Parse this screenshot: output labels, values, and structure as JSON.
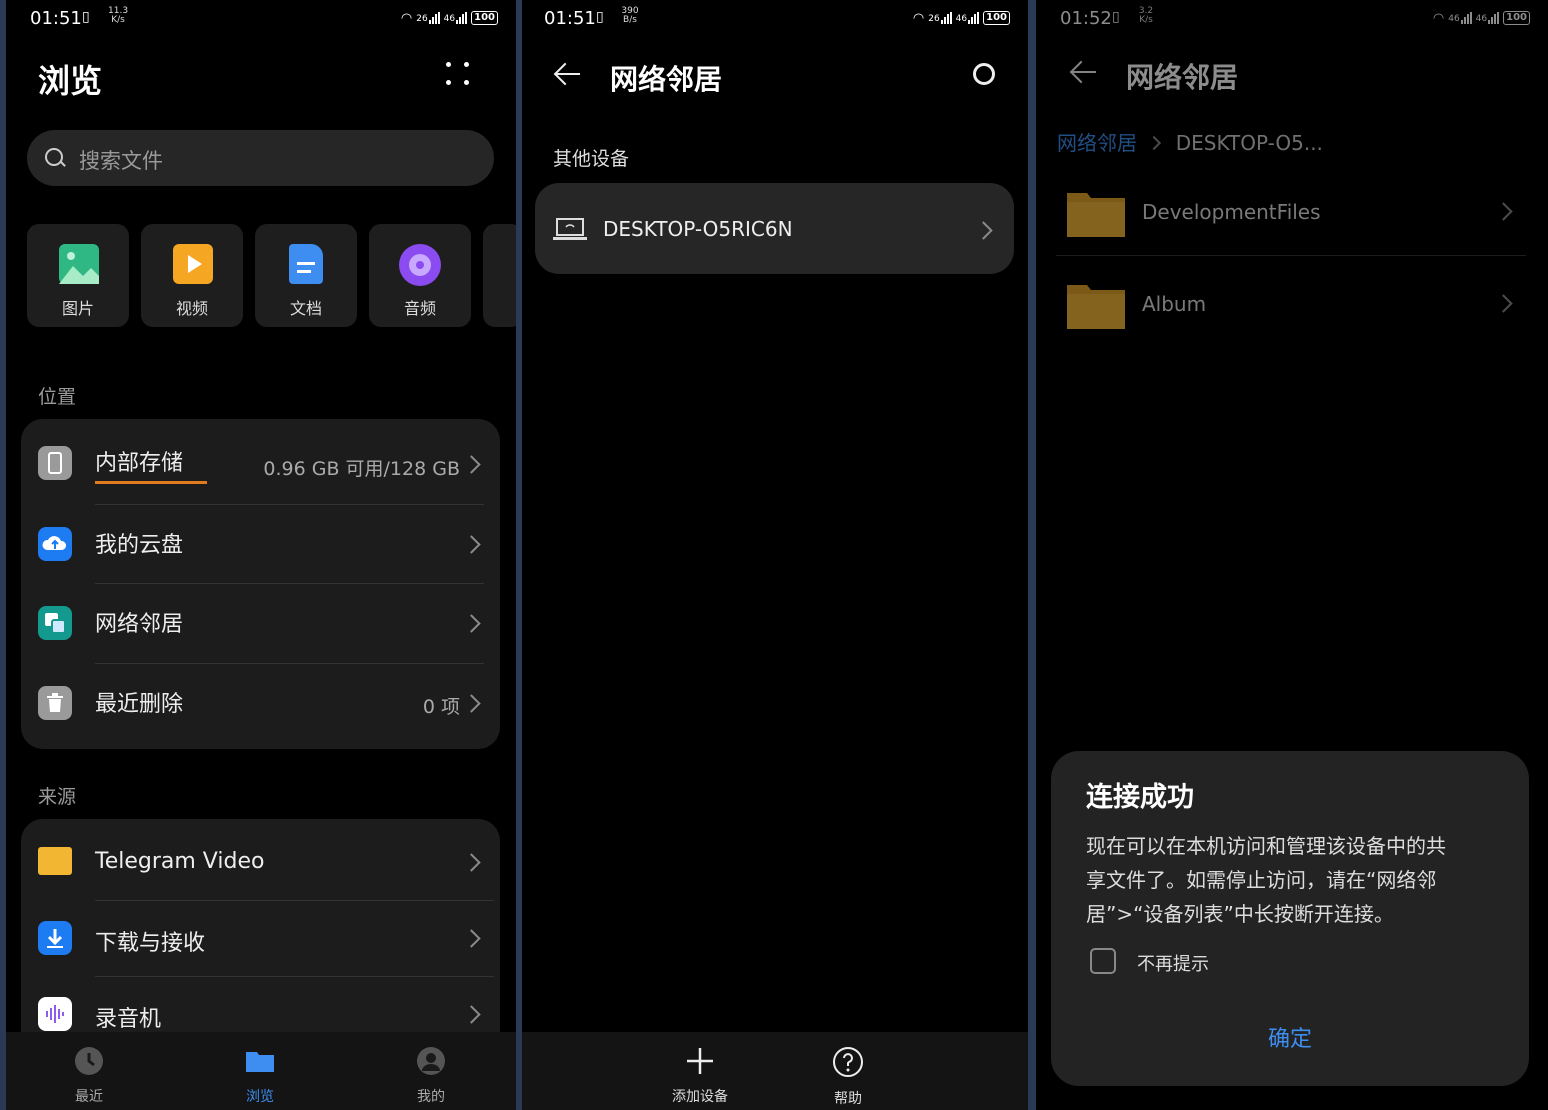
{
  "screen1": {
    "status": {
      "time": "01:51",
      "speed_top": "11.3",
      "speed_bottom": "K/s",
      "sig1": "26",
      "sig2": "46",
      "battery": "100"
    },
    "title": "浏览",
    "search_placeholder": "搜索文件",
    "categories": [
      {
        "label": "图片",
        "icon": "image-icon",
        "color": "#2fb884"
      },
      {
        "label": "视频",
        "icon": "video-icon",
        "color": "#f5a623"
      },
      {
        "label": "文档",
        "icon": "document-icon",
        "color": "#3d8ef0"
      },
      {
        "label": "音频",
        "icon": "audio-icon",
        "color": "#8a4cf0"
      }
    ],
    "locations_title": "位置",
    "locations": [
      {
        "label": "内部存储",
        "value": "0.96 GB 可用/128 GB",
        "icon": "phone-icon"
      },
      {
        "label": "我的云盘",
        "value": "",
        "icon": "cloud-icon"
      },
      {
        "label": "网络邻居",
        "value": "",
        "icon": "network-icon"
      },
      {
        "label": "最近删除",
        "value": "0 项",
        "icon": "trash-icon"
      }
    ],
    "sources_title": "来源",
    "sources": [
      {
        "label": "Telegram Video",
        "icon": "folder-icon"
      },
      {
        "label": "下载与接收",
        "icon": "download-icon"
      },
      {
        "label": "录音机",
        "icon": "recorder-icon"
      }
    ],
    "nav": [
      {
        "label": "最近",
        "icon": "clock-icon"
      },
      {
        "label": "浏览",
        "icon": "folder-icon"
      },
      {
        "label": "我的",
        "icon": "user-icon"
      }
    ],
    "accent": "#3d8ef0"
  },
  "screen2": {
    "status": {
      "time": "01:51",
      "speed_top": "390",
      "speed_bottom": "B/s",
      "sig1": "26",
      "sig2": "46",
      "battery": "100"
    },
    "title": "网络邻居",
    "section": "其他设备",
    "device": "DESKTOP-O5RIC6N",
    "nav": [
      {
        "label": "添加设备",
        "icon": "plus-icon"
      },
      {
        "label": "帮助",
        "icon": "help-icon"
      }
    ]
  },
  "screen3": {
    "status": {
      "time": "01:52",
      "speed_top": "3.2",
      "speed_bottom": "K/s",
      "sig1": "46",
      "sig2": "46",
      "battery": "100"
    },
    "title": "网络邻居",
    "breadcrumb_root": "网络邻居",
    "breadcrumb_current": "DESKTOP-O5...",
    "folders": [
      {
        "label": "DevelopmentFiles",
        "icon": "folder-icon"
      },
      {
        "label": "Album",
        "icon": "folder-icon"
      }
    ],
    "dialog": {
      "title": "连接成功",
      "line1": "现在可以在本机访问和管理该设备中的共",
      "line2": "享文件了。如需停止访问，请在“网络邻",
      "line3": "居”>“设备列表”中长按断开连接。",
      "checkbox_label": "不再提示",
      "checked": false,
      "confirm": "确定"
    },
    "accent": "#3d8ef0"
  }
}
